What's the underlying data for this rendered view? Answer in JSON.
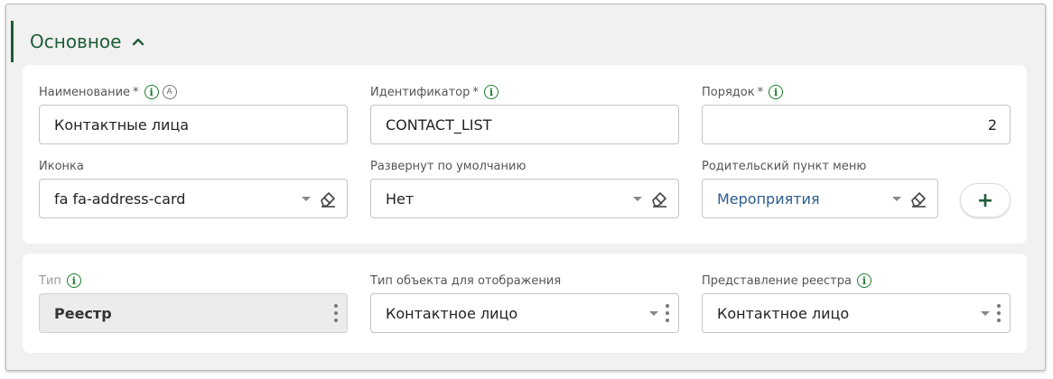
{
  "section": {
    "title": "Основное",
    "chevron_icon": "chevron-up-icon"
  },
  "card1": {
    "name": {
      "label": "Наименование",
      "required_mark": "*",
      "info_icon": "info-icon",
      "auto_badge": "A",
      "value": "Контактные лица"
    },
    "identifier": {
      "label": "Идентификатор",
      "required_mark": "*",
      "info_icon": "info-icon",
      "value": "CONTACT_LIST"
    },
    "order": {
      "label": "Порядок",
      "required_mark": "*",
      "info_icon": "info-icon",
      "value": "2"
    },
    "icon": {
      "label": "Иконка",
      "value": "fa fa-address-card"
    },
    "expanded_default": {
      "label": "Развернут по умолчанию",
      "value": "Нет"
    },
    "parent_menu": {
      "label": "Родительский пункт меню",
      "value": "Мероприятия"
    },
    "add_button": {
      "label": "+"
    }
  },
  "card2": {
    "type": {
      "label": "Тип",
      "info_icon": "info-icon",
      "value": "Реестр"
    },
    "object_type": {
      "label": "Тип объекта для отображения",
      "value": "Контактное лицо"
    },
    "registry_view": {
      "label": "Представление реестра",
      "info_icon": "info-icon",
      "value": "Контактное лицо"
    }
  },
  "colors": {
    "accent": "#1e5d37",
    "info": "#1b7d2d",
    "link": "#2c5d8f"
  }
}
